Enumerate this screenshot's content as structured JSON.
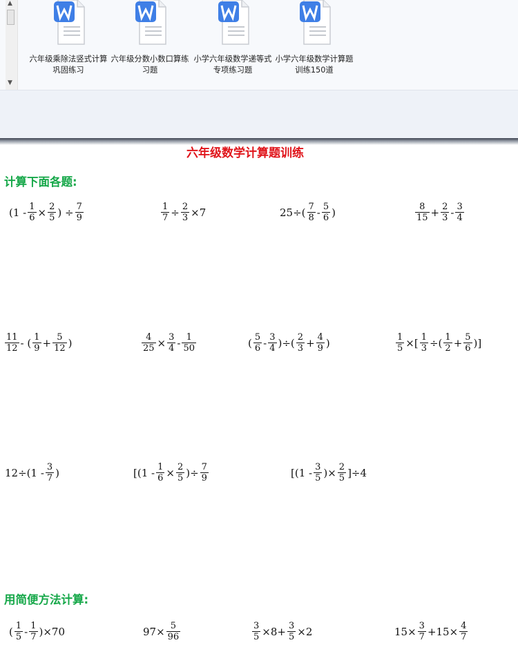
{
  "files": [
    {
      "name": "六年级乘除法竖式计算巩固练习"
    },
    {
      "name": "六年级分数小数口算练习题"
    },
    {
      "name": "小学六年级数学递等式专项练习题"
    },
    {
      "name": "小学六年级数学计算题训练150道"
    }
  ],
  "doc": {
    "title": "六年级数学计算题训练",
    "section1": "计算下面各题:",
    "section2": "用简便方法计算:"
  },
  "problems": [
    [
      "(1 -",
      {
        "n": "1",
        "d": "6"
      },
      "×",
      {
        "n": "2",
        "d": "5"
      },
      ") ÷",
      {
        "n": "7",
        "d": "9"
      }
    ],
    [
      {
        "n": "1",
        "d": "7"
      },
      "÷",
      {
        "n": "2",
        "d": "3"
      },
      "×7"
    ],
    [
      "25÷(",
      {
        "n": "7",
        "d": "8"
      },
      "-",
      {
        "n": "5",
        "d": "6"
      },
      ")"
    ],
    [
      {
        "n": "8",
        "d": "15"
      },
      "+",
      {
        "n": "2",
        "d": "3"
      },
      "-",
      {
        "n": "3",
        "d": "4"
      }
    ],
    [
      {
        "n": "11",
        "d": "12"
      },
      "- (",
      {
        "n": "1",
        "d": "9"
      },
      "+",
      {
        "n": "5",
        "d": "12"
      },
      ")"
    ],
    [
      {
        "n": "4",
        "d": "25"
      },
      "×",
      {
        "n": "3",
        "d": "4"
      },
      "-",
      {
        "n": "1",
        "d": "50"
      }
    ],
    [
      "(",
      {
        "n": "5",
        "d": "6"
      },
      "-",
      {
        "n": "3",
        "d": "4"
      },
      ")÷(",
      {
        "n": "2",
        "d": "3"
      },
      "+",
      {
        "n": "4",
        "d": "9"
      },
      ")"
    ],
    [
      {
        "n": "1",
        "d": "5"
      },
      "×[",
      {
        "n": "1",
        "d": "3"
      },
      "÷(",
      {
        "n": "1",
        "d": "2"
      },
      "+",
      {
        "n": "5",
        "d": "6"
      },
      ")]"
    ],
    [
      "12÷(1 -",
      {
        "n": "3",
        "d": "7"
      },
      ")"
    ],
    [
      "[(1 -",
      {
        "n": "1",
        "d": "6"
      },
      "×",
      {
        "n": "2",
        "d": "5"
      },
      ")÷",
      {
        "n": "7",
        "d": "9"
      }
    ],
    [
      "[(1 -",
      {
        "n": "3",
        "d": "5"
      },
      ")×",
      {
        "n": "2",
        "d": "5"
      },
      "]÷4"
    ],
    [
      "(",
      {
        "n": "1",
        "d": "5"
      },
      "-",
      {
        "n": "1",
        "d": "7"
      },
      ")×70"
    ],
    [
      "97×",
      {
        "n": "5",
        "d": "96"
      }
    ],
    [
      {
        "n": "3",
        "d": "5"
      },
      "×8+",
      {
        "n": "3",
        "d": "5"
      },
      "×2"
    ],
    [
      "15×",
      {
        "n": "3",
        "d": "7"
      },
      "+15×",
      {
        "n": "4",
        "d": "7"
      }
    ]
  ]
}
